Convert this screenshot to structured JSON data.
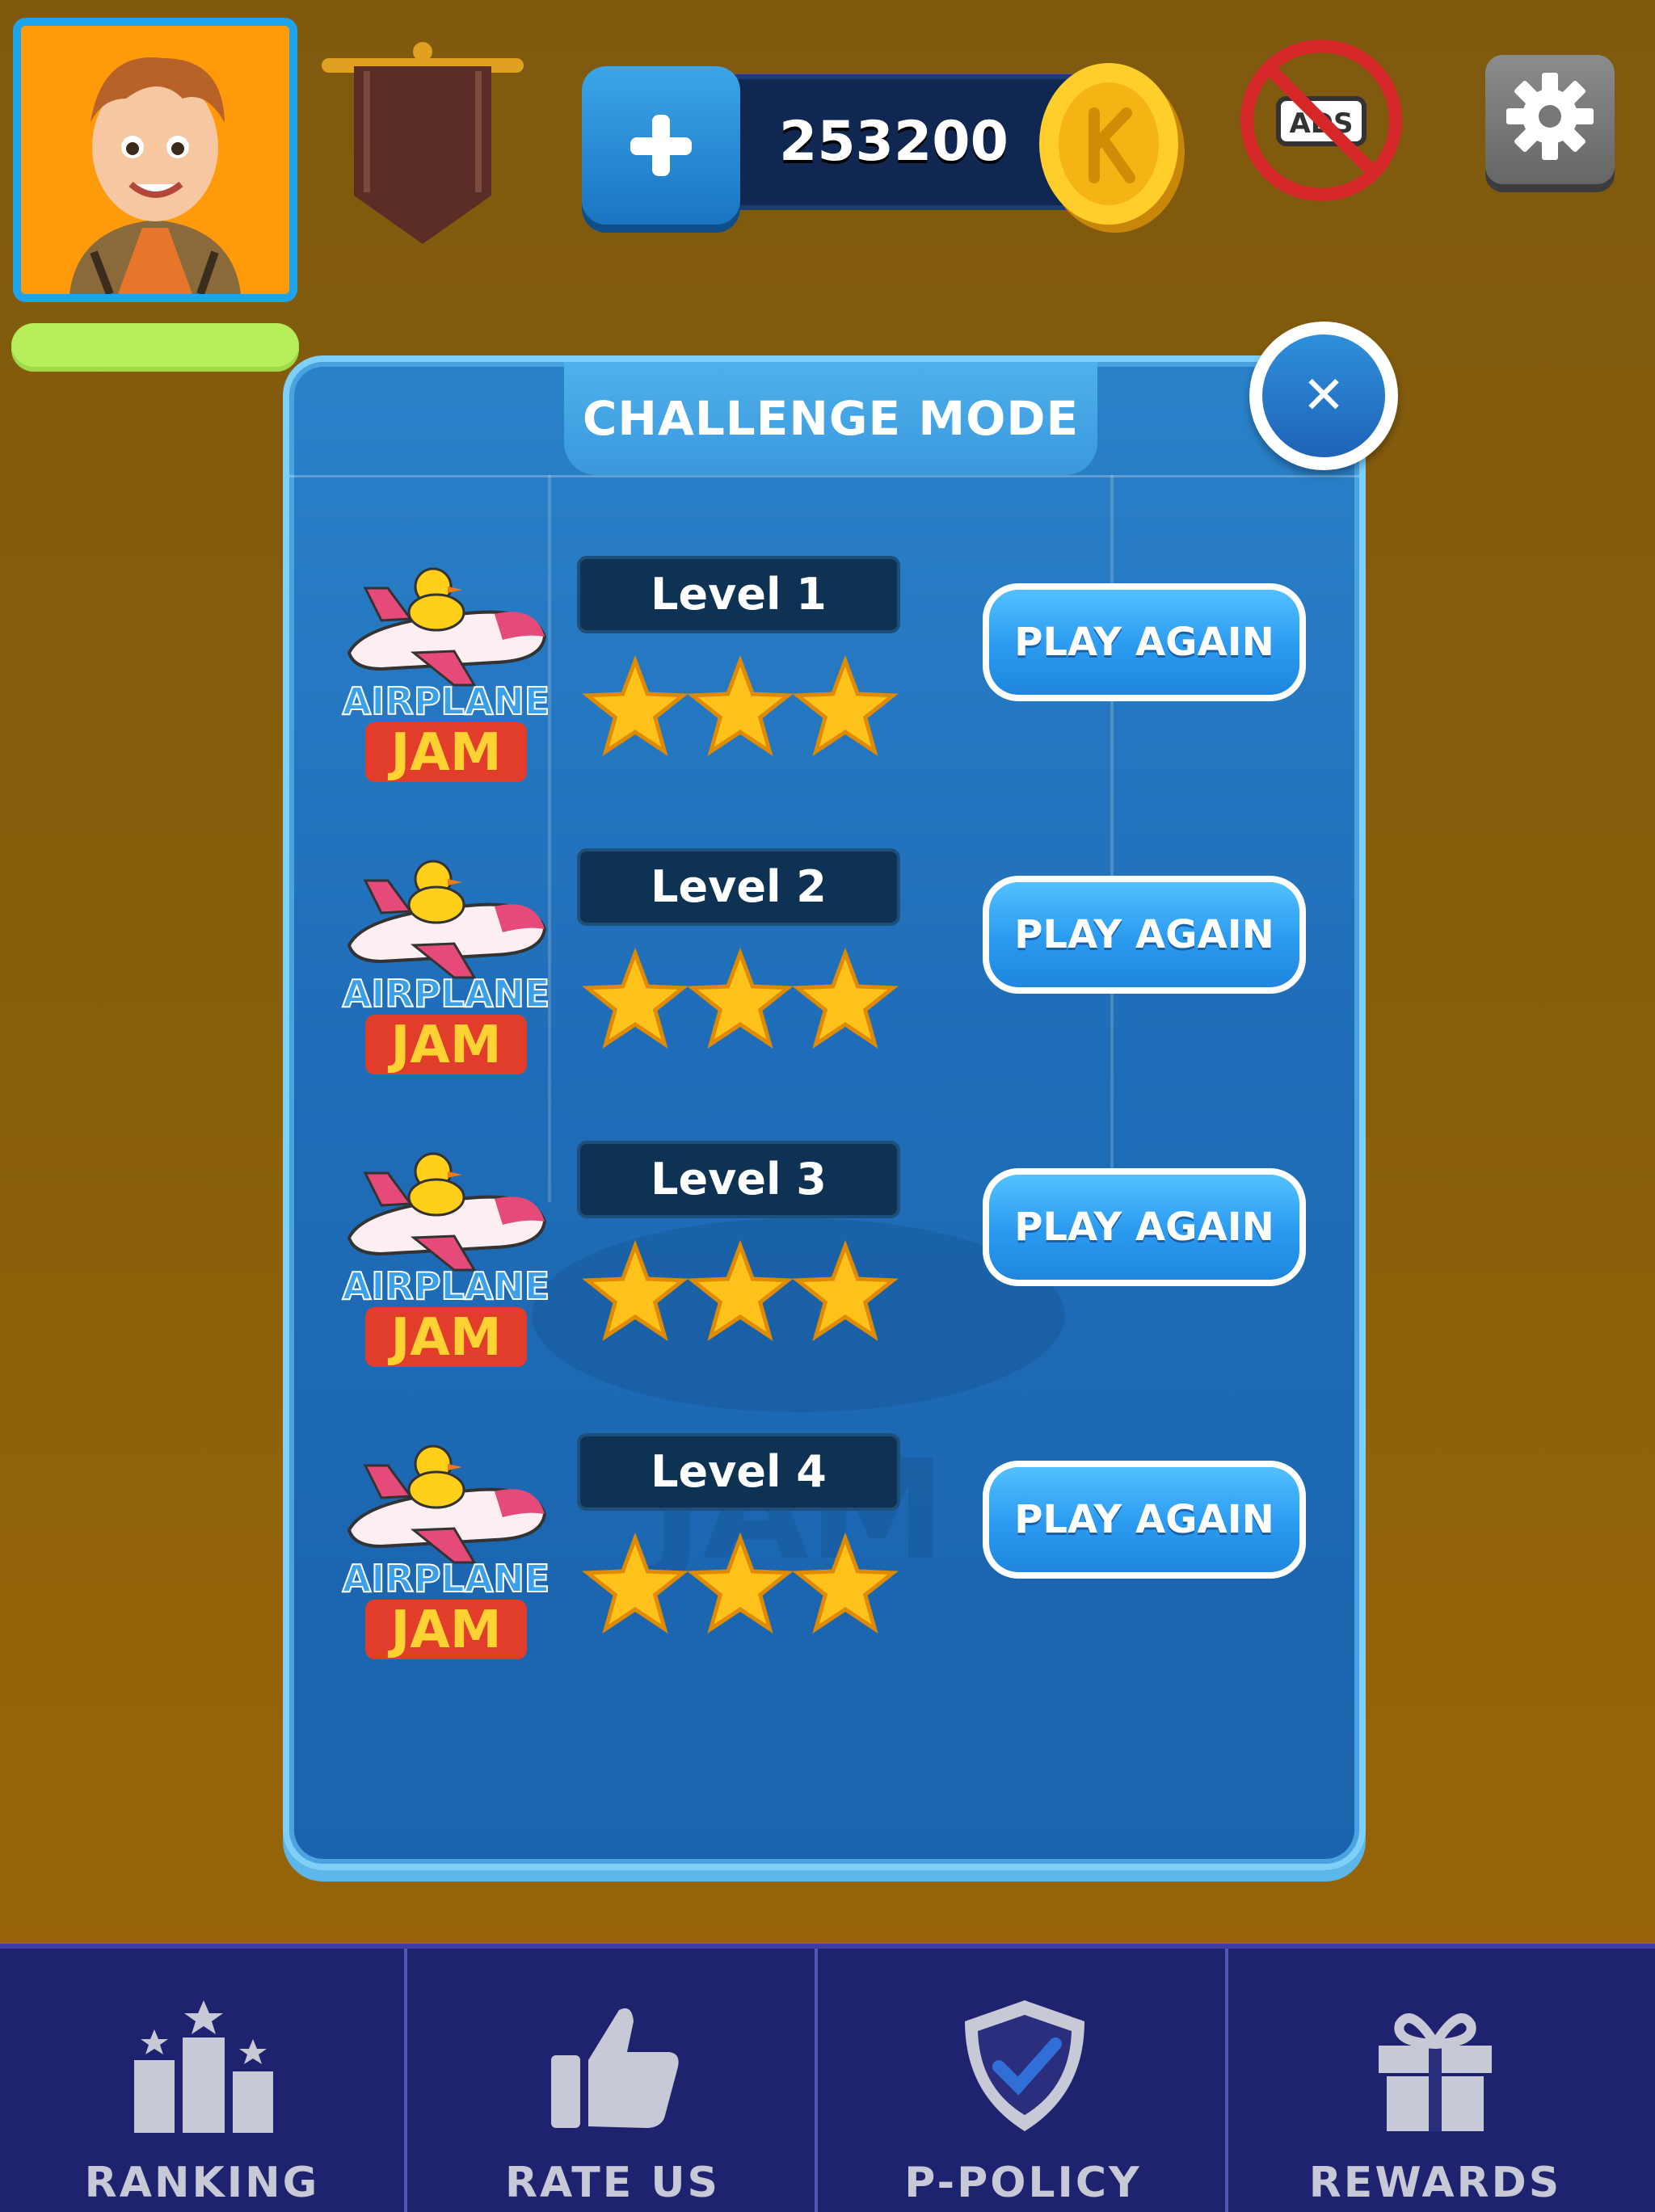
{
  "currency": {
    "coins": "253200"
  },
  "modal": {
    "title": "CHALLENGE MODE",
    "close_icon": "close-icon",
    "levels": [
      {
        "label": "Level 1",
        "stars": 3,
        "button": "PLAY AGAIN",
        "logo_text_1": "AIRPLANE",
        "logo_text_2": "JAM"
      },
      {
        "label": "Level 2",
        "stars": 3,
        "button": "PLAY AGAIN",
        "logo_text_1": "AIRPLANE",
        "logo_text_2": "JAM"
      },
      {
        "label": "Level 3",
        "stars": 3,
        "button": "PLAY AGAIN",
        "logo_text_1": "AIRPLANE",
        "logo_text_2": "JAM"
      },
      {
        "label": "Level 4",
        "stars": 3,
        "button": "PLAY AGAIN",
        "logo_text_1": "AIRPLANE",
        "logo_text_2": "JAM"
      }
    ]
  },
  "nav": {
    "items": [
      {
        "label": "RANKING",
        "icon": "podium-icon"
      },
      {
        "label": "RATE US",
        "icon": "thumbs-up-icon"
      },
      {
        "label": "P-POLICY",
        "icon": "shield-check-icon"
      },
      {
        "label": "REWARDS",
        "icon": "gift-icon"
      }
    ]
  },
  "top": {
    "noads_icon": "no-ads-icon",
    "settings_icon": "gear-icon",
    "ads_text": "ADS"
  },
  "colors": {
    "modal_blue": "#2a82c9",
    "background": "#8a5f0a",
    "nav": "#1f226e",
    "button_blue": "#2a9aef"
  }
}
